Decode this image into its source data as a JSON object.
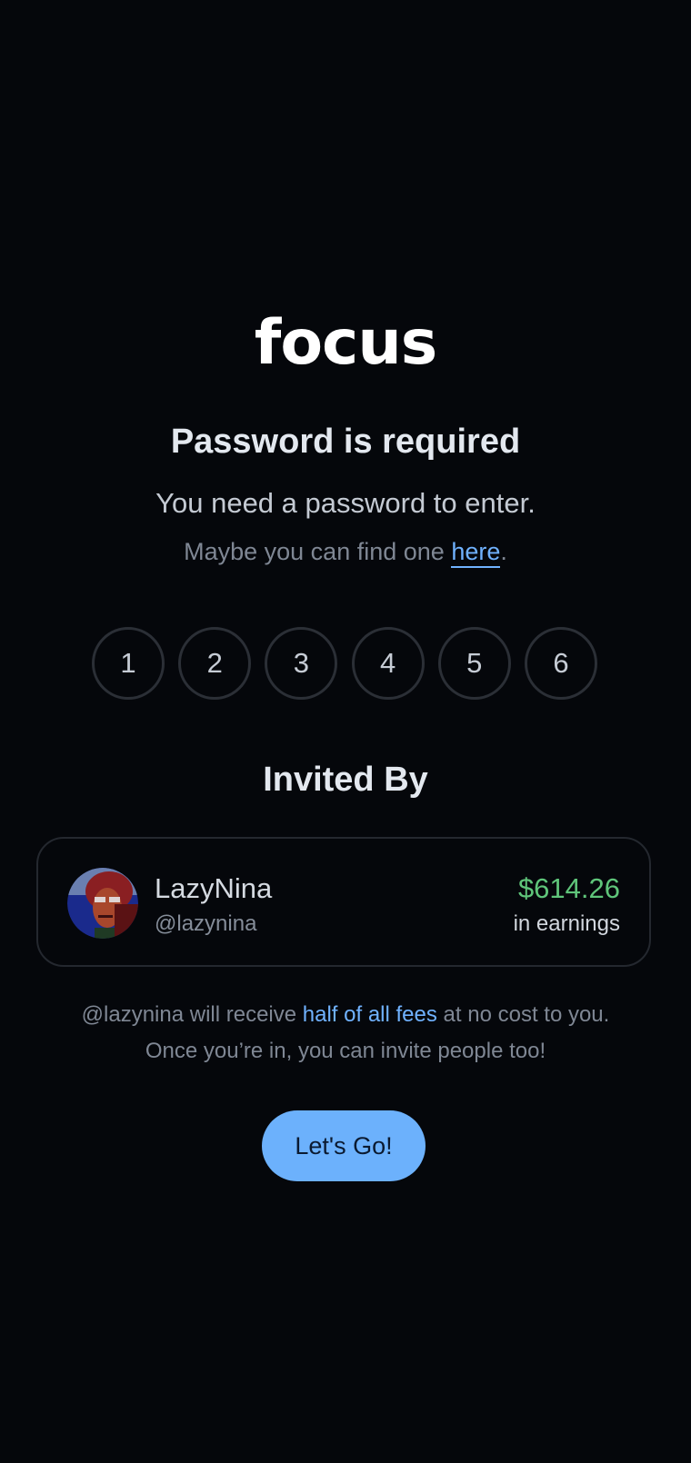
{
  "brand": {
    "logo_text": "focus"
  },
  "password_prompt": {
    "title": "Password is required",
    "subtitle": "You need a password to enter.",
    "hint_prefix": "Maybe you can find one ",
    "hint_link": "here",
    "hint_suffix": "."
  },
  "code_digits": [
    "1",
    "2",
    "3",
    "4",
    "5",
    "6"
  ],
  "invite": {
    "title": "Invited By",
    "inviter": {
      "name": "LazyNina",
      "handle": "@lazynina",
      "earnings": "$614.26",
      "earnings_label": "in earnings",
      "avatar_icon": "user-avatar-portrait"
    },
    "info_line1_prefix": "@lazynina will receive ",
    "info_line1_highlight": "half of all fees",
    "info_line1_suffix": " at no cost to you.",
    "info_line2": "Once you’re in, you can invite people too!"
  },
  "actions": {
    "go_label": "Let's Go!"
  },
  "colors": {
    "background": "#05070b",
    "accent": "#6cb1fc",
    "link": "#70b2ff",
    "earnings": "#5fc57a"
  }
}
